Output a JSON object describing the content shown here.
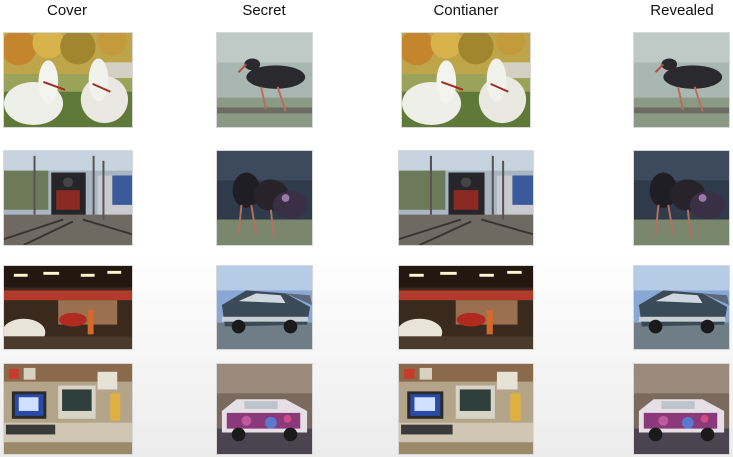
{
  "headers": {
    "cover": "Cover",
    "secret": "Secret",
    "container": "Contianer",
    "revealed": "Revealed"
  },
  "rows": [
    {
      "cover": "horses-image",
      "secret": "stork-image"
    },
    {
      "cover": "train-station-image",
      "secret": "storks-pair-image"
    },
    {
      "cover": "garage-image",
      "secret": "car-image"
    },
    {
      "cover": "office-desk-image",
      "secret": "painted-car-image"
    }
  ]
}
